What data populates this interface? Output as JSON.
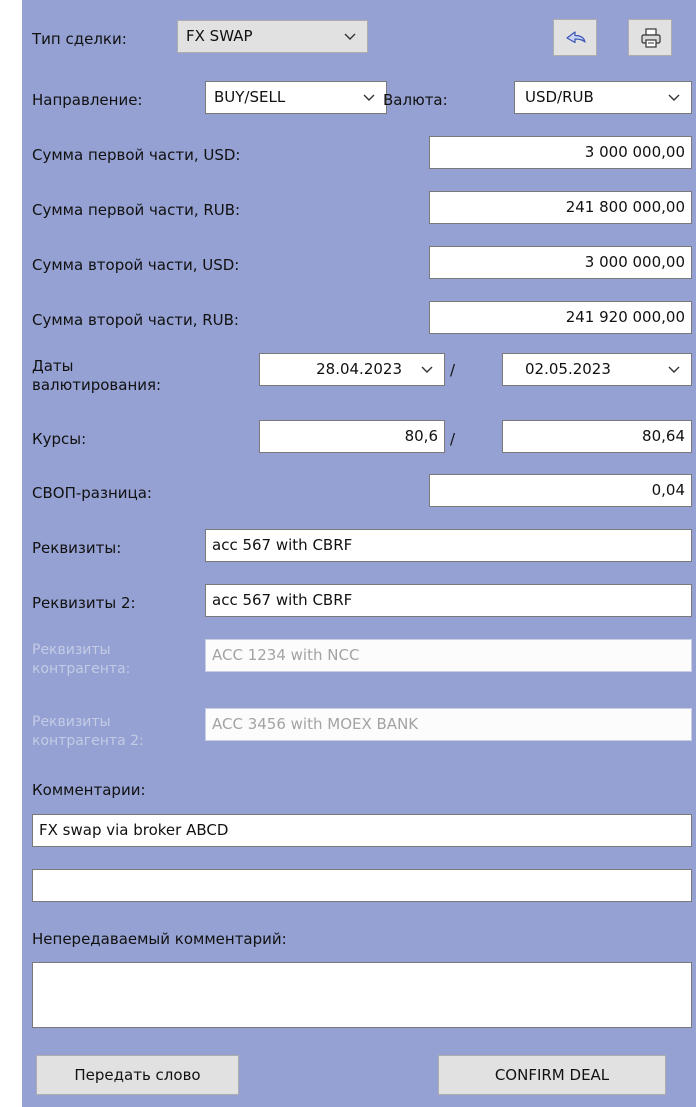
{
  "deal_type": {
    "label": "Тип сделки:",
    "value": "FX SWAP"
  },
  "toolbar": {
    "back_icon": "undo-arrow-icon",
    "print_icon": "printer-icon"
  },
  "direction": {
    "label": "Направление:",
    "value": "BUY/SELL"
  },
  "currency": {
    "label": "Валюта:",
    "value": "USD/RUB"
  },
  "amounts": [
    {
      "label": "Сумма первой части, USD:",
      "value": "3 000 000,00"
    },
    {
      "label": "Сумма первой части, RUB:",
      "value": "241 800 000,00"
    },
    {
      "label": "Сумма второй части, USD:",
      "value": "3 000 000,00"
    },
    {
      "label": "Сумма второй части, RUB:",
      "value": "241 920 000,00"
    }
  ],
  "value_dates": {
    "label_line1": "Даты",
    "label_line2": "валютирования:",
    "first": "28.04.2023",
    "separator": "/",
    "second": "02.05.2023"
  },
  "rates": {
    "label": "Курсы:",
    "first": "80,6",
    "separator": "/",
    "second": "80,64"
  },
  "swap_diff": {
    "label": "СВОП-разница:",
    "value": "0,04"
  },
  "requisites": {
    "label": "Реквизиты:",
    "value": "acc 567 with CBRF"
  },
  "requisites2": {
    "label": "Реквизиты 2:",
    "value": "acc 567 with CBRF"
  },
  "cp_requisites": {
    "label_line1": "Реквизиты",
    "label_line2": "контрагента:",
    "value": "ACC 1234 with NCC"
  },
  "cp_requisites2": {
    "label_line1": "Реквизиты",
    "label_line2": "контрагента 2:",
    "value": "ACC 3456 with MOEX BANK"
  },
  "comments": {
    "label": "Комментарии:",
    "line1": "FX swap via broker ABCD",
    "line2": ""
  },
  "private_comment": {
    "label": "Непередаваемый комментарий:",
    "value": ""
  },
  "buttons": {
    "pass_word": "Передать слово",
    "confirm": "CONFIRM DEAL"
  },
  "colors": {
    "panel": "#95a1d2",
    "disabled_text": "#c4cbe6",
    "button_bg": "#e1e1e1"
  }
}
